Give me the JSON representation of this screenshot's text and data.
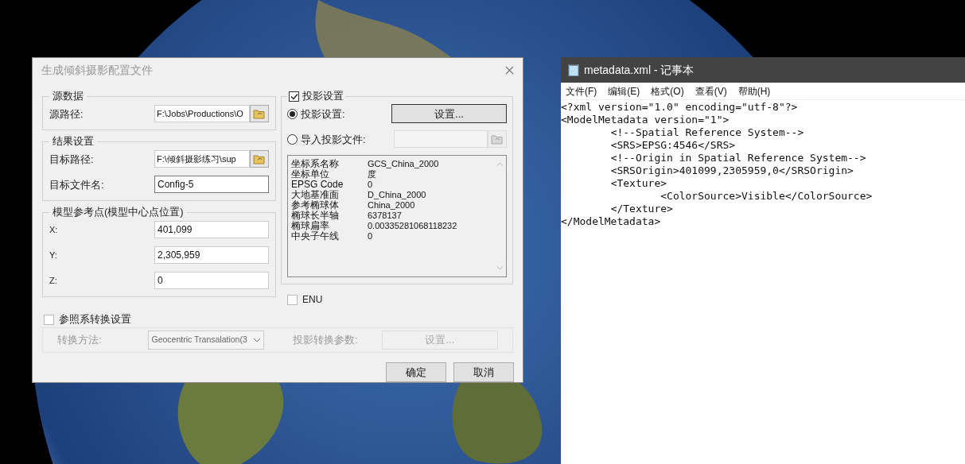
{
  "dialog": {
    "title": "生成倾斜摄影配置文件",
    "left_groups": [
      {
        "title": "源数据",
        "rows": [
          {
            "label": "源路径:",
            "value": "F:\\Jobs\\Productions\\O",
            "kind": "browse"
          }
        ]
      },
      {
        "title": "结果设置",
        "rows": [
          {
            "label": "目标路径:",
            "value": "F:\\倾斜摄影练习\\sup",
            "kind": "browse"
          },
          {
            "label": "目标文件名:",
            "value": "Config-5",
            "kind": "text"
          }
        ]
      },
      {
        "title": "模型参考点(模型中心点位置)",
        "rows": [
          {
            "label": "X:",
            "value": "401,099",
            "kind": "coord"
          },
          {
            "label": "Y:",
            "value": "2,305,959",
            "kind": "coord"
          },
          {
            "label": "Z:",
            "value": "0",
            "kind": "coord"
          }
        ]
      }
    ],
    "projection": {
      "title": "投影设置",
      "checked": true,
      "options": [
        {
          "label": "投影设置:",
          "selected": true,
          "kind": "button",
          "button": "设置..."
        },
        {
          "label": "导入投影文件:",
          "selected": false,
          "kind": "file"
        }
      ],
      "info": [
        {
          "name": "坐标系名称",
          "value": "GCS_China_2000"
        },
        {
          "name": "坐标单位",
          "value": "度"
        },
        {
          "name": "EPSG Code",
          "value": "0"
        },
        {
          "name": "大地基准面",
          "value": "D_China_2000"
        },
        {
          "name": "参考椭球体",
          "value": "China_2000"
        },
        {
          "name": "椭球长半轴",
          "value": "6378137"
        },
        {
          "name": "椭球扁率",
          "value": "0.00335281068118232"
        },
        {
          "name": "中央子午线",
          "value": "0"
        }
      ]
    },
    "enu": {
      "label": "ENU",
      "checked": false
    },
    "transform": {
      "title": "参照系转换设置",
      "checked": false,
      "method_label": "转换方法:",
      "method_value": "Geocentric Transalation(3",
      "params_label": "投影转换参数:",
      "params_button": "设置..."
    },
    "buttons": [
      "确定",
      "取消"
    ]
  },
  "notepad": {
    "title": "metadata.xml - 记事本",
    "menu": [
      "文件(F)",
      "编辑(E)",
      "格式(O)",
      "查看(V)",
      "帮助(H)"
    ],
    "lines": [
      "<?xml version=\"1.0\" encoding=\"utf-8\"?>",
      "<ModelMetadata version=\"1\">",
      "\t<!--Spatial Reference System-->",
      "\t<SRS>EPSG:4546</SRS>",
      "\t<!--Origin in Spatial Reference System-->",
      "\t<SRSOrigin>401099,2305959,0</SRSOrigin>",
      "\t<Texture>",
      "\t\t<ColorSource>Visible</ColorSource>",
      "\t</Texture>",
      "</ModelMetadata>"
    ]
  }
}
